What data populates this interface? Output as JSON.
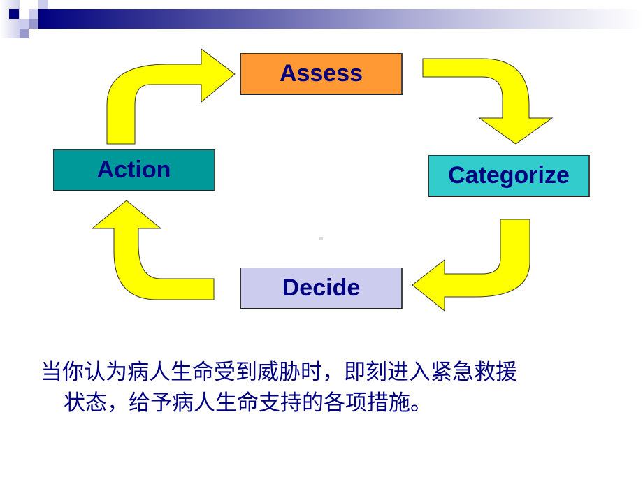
{
  "slide": {
    "decoration": {
      "colors": {
        "navy": "#000080",
        "medium": "#9999cc",
        "light": "#ccccee"
      }
    },
    "cycle": {
      "steps": [
        {
          "label": "Assess",
          "color": "#ff9933"
        },
        {
          "label": "Categorize",
          "color": "#33cccc"
        },
        {
          "label": "Decide",
          "color": "#ccccee"
        },
        {
          "label": "Action",
          "color": "#009999"
        }
      ],
      "arrow_color": "#ffff00",
      "text_color": "#000080"
    },
    "caption": {
      "line1": "当你认为病人生命受到威胁时，即刻进入紧急救援",
      "line2": "状态，给予病人生命支持的各项措施。"
    }
  }
}
